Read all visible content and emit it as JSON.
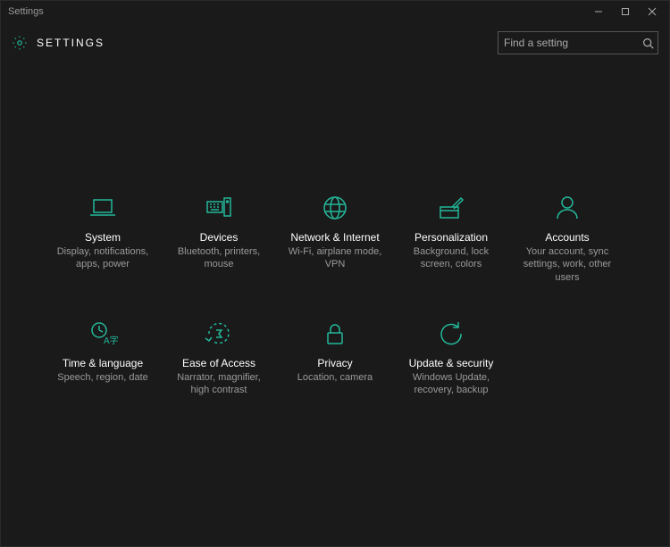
{
  "window": {
    "title": "Settings"
  },
  "header": {
    "title": "SETTINGS"
  },
  "search": {
    "placeholder": "Find a setting"
  },
  "accent": "#22b89a",
  "tiles": [
    {
      "id": "system",
      "title": "System",
      "desc": "Display, notifications, apps, power"
    },
    {
      "id": "devices",
      "title": "Devices",
      "desc": "Bluetooth, printers, mouse"
    },
    {
      "id": "network",
      "title": "Network & Internet",
      "desc": "Wi-Fi, airplane mode, VPN"
    },
    {
      "id": "personalization",
      "title": "Personalization",
      "desc": "Background, lock screen, colors"
    },
    {
      "id": "accounts",
      "title": "Accounts",
      "desc": "Your account, sync settings, work, other users"
    },
    {
      "id": "time",
      "title": "Time & language",
      "desc": "Speech, region, date"
    },
    {
      "id": "ease",
      "title": "Ease of Access",
      "desc": "Narrator, magnifier, high contrast"
    },
    {
      "id": "privacy",
      "title": "Privacy",
      "desc": "Location, camera"
    },
    {
      "id": "update",
      "title": "Update & security",
      "desc": "Windows Update, recovery, backup"
    }
  ]
}
